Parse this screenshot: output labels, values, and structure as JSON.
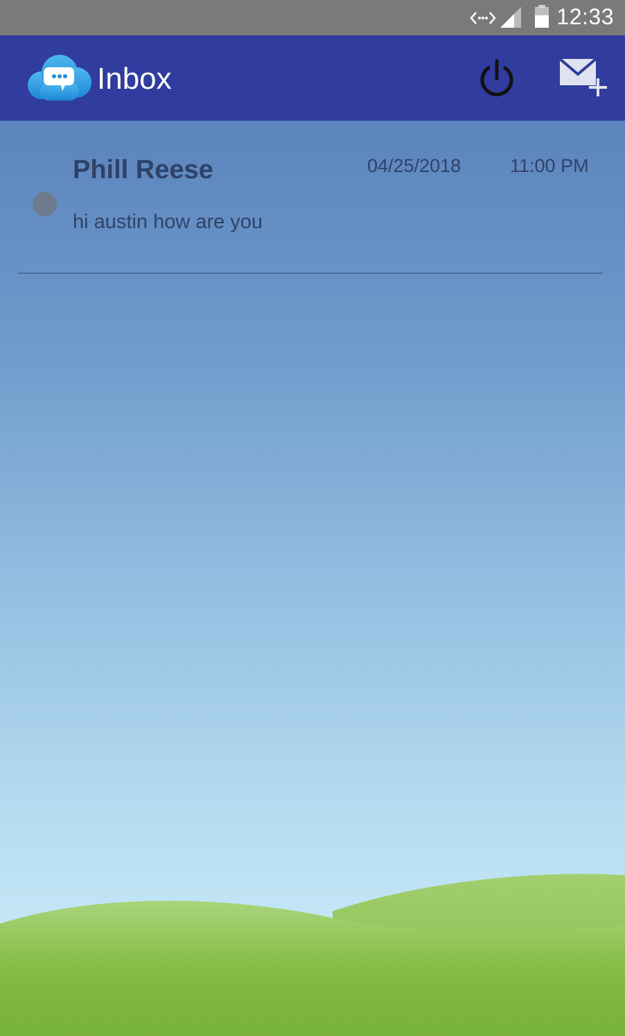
{
  "status_bar": {
    "time": "12:33",
    "icons": [
      "data-transfer-icon",
      "signal-icon",
      "battery-icon"
    ]
  },
  "app_bar": {
    "title": "Inbox",
    "logo_icon": "chat-cloud-logo",
    "actions": [
      "power-icon",
      "compose-mail-icon"
    ],
    "background_color": "#303c9e"
  },
  "messages": [
    {
      "sender": "Phill Reese",
      "date": "04/25/2018",
      "time": "11:00 PM",
      "preview": "hi austin how are you",
      "status_dot_color": "#6e7b8d"
    }
  ],
  "colors": {
    "status_bar": "#7a7a7a",
    "text": "#2f4267",
    "sky_top": "#5b84bd",
    "sky_bottom": "#cdeef9",
    "grass": "#7cb63d"
  }
}
